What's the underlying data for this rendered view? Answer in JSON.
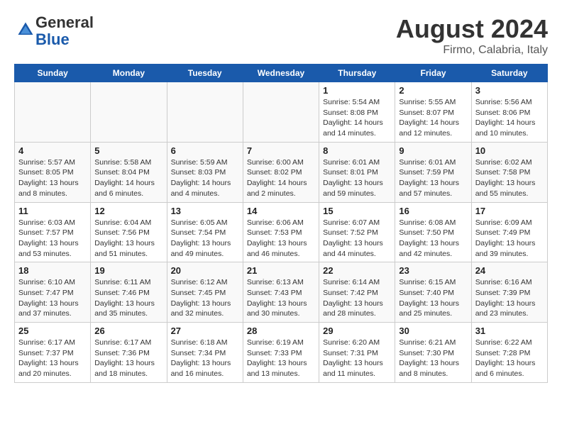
{
  "header": {
    "logo": {
      "general": "General",
      "blue": "Blue"
    },
    "month_year": "August 2024",
    "location": "Firmo, Calabria, Italy"
  },
  "weekdays": [
    "Sunday",
    "Monday",
    "Tuesday",
    "Wednesday",
    "Thursday",
    "Friday",
    "Saturday"
  ],
  "weeks": [
    {
      "days": [
        {
          "num": "",
          "empty": true
        },
        {
          "num": "",
          "empty": true
        },
        {
          "num": "",
          "empty": true
        },
        {
          "num": "",
          "empty": true
        },
        {
          "num": "1",
          "sunrise": "5:54 AM",
          "sunset": "8:08 PM",
          "daylight": "14 hours and 14 minutes."
        },
        {
          "num": "2",
          "sunrise": "5:55 AM",
          "sunset": "8:07 PM",
          "daylight": "14 hours and 12 minutes."
        },
        {
          "num": "3",
          "sunrise": "5:56 AM",
          "sunset": "8:06 PM",
          "daylight": "14 hours and 10 minutes."
        }
      ]
    },
    {
      "days": [
        {
          "num": "4",
          "sunrise": "5:57 AM",
          "sunset": "8:05 PM",
          "daylight": "13 hours and 8 minutes."
        },
        {
          "num": "5",
          "sunrise": "5:58 AM",
          "sunset": "8:04 PM",
          "daylight": "14 hours and 6 minutes."
        },
        {
          "num": "6",
          "sunrise": "5:59 AM",
          "sunset": "8:03 PM",
          "daylight": "14 hours and 4 minutes."
        },
        {
          "num": "7",
          "sunrise": "6:00 AM",
          "sunset": "8:02 PM",
          "daylight": "14 hours and 2 minutes."
        },
        {
          "num": "8",
          "sunrise": "6:01 AM",
          "sunset": "8:01 PM",
          "daylight": "13 hours and 59 minutes."
        },
        {
          "num": "9",
          "sunrise": "6:01 AM",
          "sunset": "7:59 PM",
          "daylight": "13 hours and 57 minutes."
        },
        {
          "num": "10",
          "sunrise": "6:02 AM",
          "sunset": "7:58 PM",
          "daylight": "13 hours and 55 minutes."
        }
      ]
    },
    {
      "days": [
        {
          "num": "11",
          "sunrise": "6:03 AM",
          "sunset": "7:57 PM",
          "daylight": "13 hours and 53 minutes."
        },
        {
          "num": "12",
          "sunrise": "6:04 AM",
          "sunset": "7:56 PM",
          "daylight": "13 hours and 51 minutes."
        },
        {
          "num": "13",
          "sunrise": "6:05 AM",
          "sunset": "7:54 PM",
          "daylight": "13 hours and 49 minutes."
        },
        {
          "num": "14",
          "sunrise": "6:06 AM",
          "sunset": "7:53 PM",
          "daylight": "13 hours and 46 minutes."
        },
        {
          "num": "15",
          "sunrise": "6:07 AM",
          "sunset": "7:52 PM",
          "daylight": "13 hours and 44 minutes."
        },
        {
          "num": "16",
          "sunrise": "6:08 AM",
          "sunset": "7:50 PM",
          "daylight": "13 hours and 42 minutes."
        },
        {
          "num": "17",
          "sunrise": "6:09 AM",
          "sunset": "7:49 PM",
          "daylight": "13 hours and 39 minutes."
        }
      ]
    },
    {
      "days": [
        {
          "num": "18",
          "sunrise": "6:10 AM",
          "sunset": "7:47 PM",
          "daylight": "13 hours and 37 minutes."
        },
        {
          "num": "19",
          "sunrise": "6:11 AM",
          "sunset": "7:46 PM",
          "daylight": "13 hours and 35 minutes."
        },
        {
          "num": "20",
          "sunrise": "6:12 AM",
          "sunset": "7:45 PM",
          "daylight": "13 hours and 32 minutes."
        },
        {
          "num": "21",
          "sunrise": "6:13 AM",
          "sunset": "7:43 PM",
          "daylight": "13 hours and 30 minutes."
        },
        {
          "num": "22",
          "sunrise": "6:14 AM",
          "sunset": "7:42 PM",
          "daylight": "13 hours and 28 minutes."
        },
        {
          "num": "23",
          "sunrise": "6:15 AM",
          "sunset": "7:40 PM",
          "daylight": "13 hours and 25 minutes."
        },
        {
          "num": "24",
          "sunrise": "6:16 AM",
          "sunset": "7:39 PM",
          "daylight": "13 hours and 23 minutes."
        }
      ]
    },
    {
      "days": [
        {
          "num": "25",
          "sunrise": "6:17 AM",
          "sunset": "7:37 PM",
          "daylight": "13 hours and 20 minutes."
        },
        {
          "num": "26",
          "sunrise": "6:17 AM",
          "sunset": "7:36 PM",
          "daylight": "13 hours and 18 minutes."
        },
        {
          "num": "27",
          "sunrise": "6:18 AM",
          "sunset": "7:34 PM",
          "daylight": "13 hours and 16 minutes."
        },
        {
          "num": "28",
          "sunrise": "6:19 AM",
          "sunset": "7:33 PM",
          "daylight": "13 hours and 13 minutes."
        },
        {
          "num": "29",
          "sunrise": "6:20 AM",
          "sunset": "7:31 PM",
          "daylight": "13 hours and 11 minutes."
        },
        {
          "num": "30",
          "sunrise": "6:21 AM",
          "sunset": "7:30 PM",
          "daylight": "13 hours and 8 minutes."
        },
        {
          "num": "31",
          "sunrise": "6:22 AM",
          "sunset": "7:28 PM",
          "daylight": "13 hours and 6 minutes."
        }
      ]
    }
  ]
}
